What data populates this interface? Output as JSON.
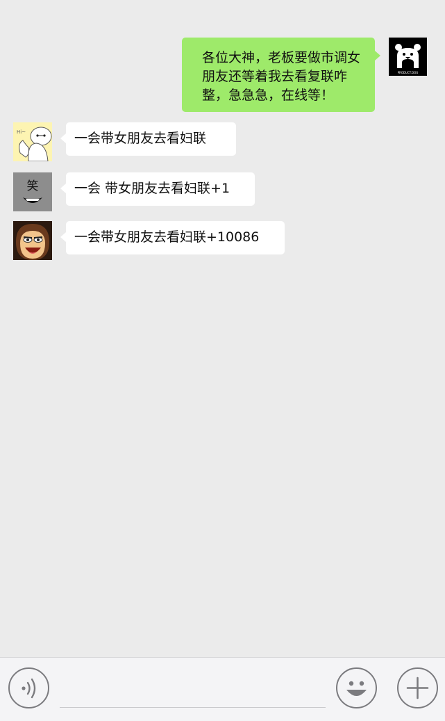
{
  "messages": [
    {
      "side": "right",
      "sender": "self",
      "avatar_icon": "bear-logo-avatar",
      "avatar_caption": "PRODUCT.DOG",
      "text": "各位大神，老板要做市调女朋友还等着我去看复联咋整，急急急，在线等！"
    },
    {
      "side": "left",
      "avatar_icon": "baymax-avatar",
      "text": "一会带女朋友去看妇联"
    },
    {
      "side": "left",
      "avatar_icon": "laugh-face-avatar",
      "avatar_caption": "笑",
      "text": "一会 带女朋友去看妇联+1"
    },
    {
      "side": "left",
      "avatar_icon": "cartoon-man-avatar",
      "text": "一会带女朋友去看妇联+10086"
    }
  ],
  "input_bar": {
    "voice_icon": "voice-icon",
    "emoji_icon": "emoji-icon",
    "plus_icon": "plus-icon",
    "input_value": ""
  },
  "colors": {
    "background": "#ebebeb",
    "self_bubble": "#9eea6a",
    "other_bubble": "#ffffff",
    "input_bar": "#f4f4f6"
  }
}
